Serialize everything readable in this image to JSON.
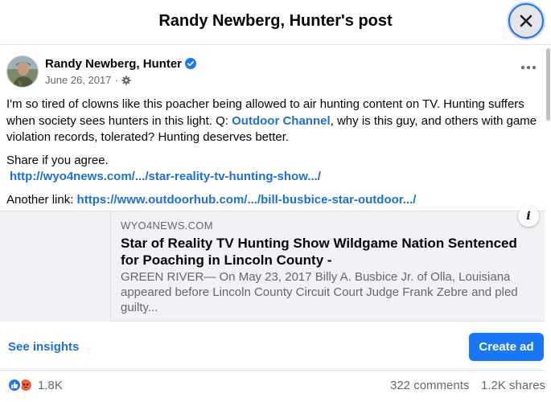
{
  "header": {
    "title": "Randy Newberg, Hunter's post"
  },
  "post": {
    "author": "Randy Newberg, Hunter",
    "date": "June 26, 2017",
    "separator": "·",
    "body_part1": "I'm so tired of clowns like this poacher being allowed to air hunting content on TV.  Hunting suffers when society sees hunters in this light.  Q: ",
    "body_mention": "Outdoor Channel",
    "body_part2": ", why is this guy, and others with game violation records, tolerated?  Hunting deserves better.",
    "share_text": "Share if you agree.",
    "link1": "http://wyo4news.com/.../star-reality-tv-hunting-show.../",
    "another_label": "Another link: ",
    "link2": "https://www.outdoorhub.com/.../bill-busbice-star-outdoor.../"
  },
  "link_card": {
    "domain": "WYO4NEWS.COM",
    "title": "Star of Reality TV Hunting Show Wildgame Nation Sentenced for Poaching in Lincoln County -",
    "description": "GREEN RIVER— On May 23, 2017 Billy A. Busbice Jr. of Olla, Louisiana appeared before Lincoln County Circuit Court Judge Frank Zebre and pled guilty...",
    "info_glyph": "i"
  },
  "actions": {
    "see_insights": "See insights",
    "create_ad": "Create ad"
  },
  "stats": {
    "reactions": "1.8K",
    "comments": "322 comments",
    "shares": "1.2K shares"
  },
  "colors": {
    "accent": "#1877f2",
    "link": "#1d6fd8",
    "secondary_text": "#65676b",
    "angry": "#f3653f"
  },
  "icons": [
    "close-icon",
    "verified-icon",
    "settings-gear-icon",
    "more-options-icon",
    "info-icon",
    "like-icon",
    "angry-icon"
  ]
}
